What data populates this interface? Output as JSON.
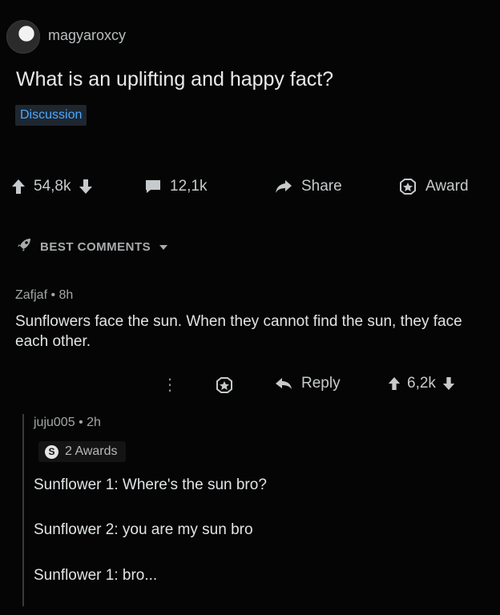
{
  "post": {
    "username": "magyaroxcy",
    "title": "What is an uplifting and happy fact?",
    "flair": "Discussion",
    "votes": "54,8k",
    "comments": "12,1k",
    "share_label": "Share",
    "award_label": "Award"
  },
  "sort": {
    "label": "BEST COMMENTS"
  },
  "comment": {
    "author": "Zafjaf",
    "time": "8h",
    "text": "Sunflowers face the sun.  When they cannot find the sun, they face each other.",
    "reply_label": "Reply",
    "votes": "6,2k",
    "more_glyph": "⋮"
  },
  "reply": {
    "author": "juju005",
    "time": "2h",
    "awards_label": "2 Awards",
    "award_coin": "S",
    "lines": [
      "Sunflower 1: Where's the sun bro?",
      "Sunflower 2: you are my sun bro",
      "Sunflower 1: bro..."
    ]
  },
  "separator": "•",
  "colors": {
    "background": "#050505",
    "flair_text": "#4ea9ff",
    "flair_bg": "#1e2730"
  }
}
